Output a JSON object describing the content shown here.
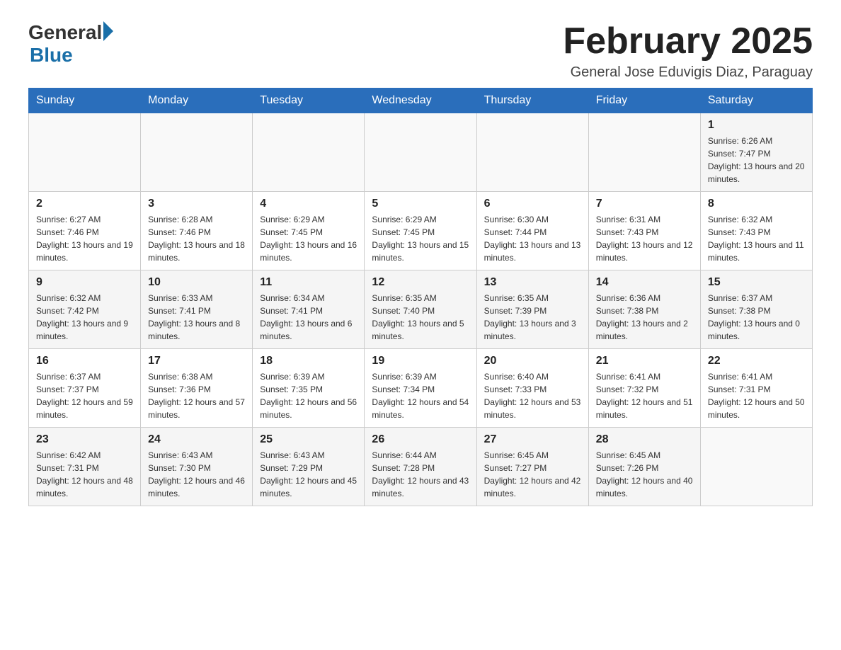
{
  "header": {
    "logo_general": "General",
    "logo_blue": "Blue",
    "month_title": "February 2025",
    "location": "General Jose Eduvigis Diaz, Paraguay"
  },
  "weekdays": [
    "Sunday",
    "Monday",
    "Tuesday",
    "Wednesday",
    "Thursday",
    "Friday",
    "Saturday"
  ],
  "weeks": [
    [
      {
        "day": "",
        "info": ""
      },
      {
        "day": "",
        "info": ""
      },
      {
        "day": "",
        "info": ""
      },
      {
        "day": "",
        "info": ""
      },
      {
        "day": "",
        "info": ""
      },
      {
        "day": "",
        "info": ""
      },
      {
        "day": "1",
        "info": "Sunrise: 6:26 AM\nSunset: 7:47 PM\nDaylight: 13 hours and 20 minutes."
      }
    ],
    [
      {
        "day": "2",
        "info": "Sunrise: 6:27 AM\nSunset: 7:46 PM\nDaylight: 13 hours and 19 minutes."
      },
      {
        "day": "3",
        "info": "Sunrise: 6:28 AM\nSunset: 7:46 PM\nDaylight: 13 hours and 18 minutes."
      },
      {
        "day": "4",
        "info": "Sunrise: 6:29 AM\nSunset: 7:45 PM\nDaylight: 13 hours and 16 minutes."
      },
      {
        "day": "5",
        "info": "Sunrise: 6:29 AM\nSunset: 7:45 PM\nDaylight: 13 hours and 15 minutes."
      },
      {
        "day": "6",
        "info": "Sunrise: 6:30 AM\nSunset: 7:44 PM\nDaylight: 13 hours and 13 minutes."
      },
      {
        "day": "7",
        "info": "Sunrise: 6:31 AM\nSunset: 7:43 PM\nDaylight: 13 hours and 12 minutes."
      },
      {
        "day": "8",
        "info": "Sunrise: 6:32 AM\nSunset: 7:43 PM\nDaylight: 13 hours and 11 minutes."
      }
    ],
    [
      {
        "day": "9",
        "info": "Sunrise: 6:32 AM\nSunset: 7:42 PM\nDaylight: 13 hours and 9 minutes."
      },
      {
        "day": "10",
        "info": "Sunrise: 6:33 AM\nSunset: 7:41 PM\nDaylight: 13 hours and 8 minutes."
      },
      {
        "day": "11",
        "info": "Sunrise: 6:34 AM\nSunset: 7:41 PM\nDaylight: 13 hours and 6 minutes."
      },
      {
        "day": "12",
        "info": "Sunrise: 6:35 AM\nSunset: 7:40 PM\nDaylight: 13 hours and 5 minutes."
      },
      {
        "day": "13",
        "info": "Sunrise: 6:35 AM\nSunset: 7:39 PM\nDaylight: 13 hours and 3 minutes."
      },
      {
        "day": "14",
        "info": "Sunrise: 6:36 AM\nSunset: 7:38 PM\nDaylight: 13 hours and 2 minutes."
      },
      {
        "day": "15",
        "info": "Sunrise: 6:37 AM\nSunset: 7:38 PM\nDaylight: 13 hours and 0 minutes."
      }
    ],
    [
      {
        "day": "16",
        "info": "Sunrise: 6:37 AM\nSunset: 7:37 PM\nDaylight: 12 hours and 59 minutes."
      },
      {
        "day": "17",
        "info": "Sunrise: 6:38 AM\nSunset: 7:36 PM\nDaylight: 12 hours and 57 minutes."
      },
      {
        "day": "18",
        "info": "Sunrise: 6:39 AM\nSunset: 7:35 PM\nDaylight: 12 hours and 56 minutes."
      },
      {
        "day": "19",
        "info": "Sunrise: 6:39 AM\nSunset: 7:34 PM\nDaylight: 12 hours and 54 minutes."
      },
      {
        "day": "20",
        "info": "Sunrise: 6:40 AM\nSunset: 7:33 PM\nDaylight: 12 hours and 53 minutes."
      },
      {
        "day": "21",
        "info": "Sunrise: 6:41 AM\nSunset: 7:32 PM\nDaylight: 12 hours and 51 minutes."
      },
      {
        "day": "22",
        "info": "Sunrise: 6:41 AM\nSunset: 7:31 PM\nDaylight: 12 hours and 50 minutes."
      }
    ],
    [
      {
        "day": "23",
        "info": "Sunrise: 6:42 AM\nSunset: 7:31 PM\nDaylight: 12 hours and 48 minutes."
      },
      {
        "day": "24",
        "info": "Sunrise: 6:43 AM\nSunset: 7:30 PM\nDaylight: 12 hours and 46 minutes."
      },
      {
        "day": "25",
        "info": "Sunrise: 6:43 AM\nSunset: 7:29 PM\nDaylight: 12 hours and 45 minutes."
      },
      {
        "day": "26",
        "info": "Sunrise: 6:44 AM\nSunset: 7:28 PM\nDaylight: 12 hours and 43 minutes."
      },
      {
        "day": "27",
        "info": "Sunrise: 6:45 AM\nSunset: 7:27 PM\nDaylight: 12 hours and 42 minutes."
      },
      {
        "day": "28",
        "info": "Sunrise: 6:45 AM\nSunset: 7:26 PM\nDaylight: 12 hours and 40 minutes."
      },
      {
        "day": "",
        "info": ""
      }
    ]
  ]
}
